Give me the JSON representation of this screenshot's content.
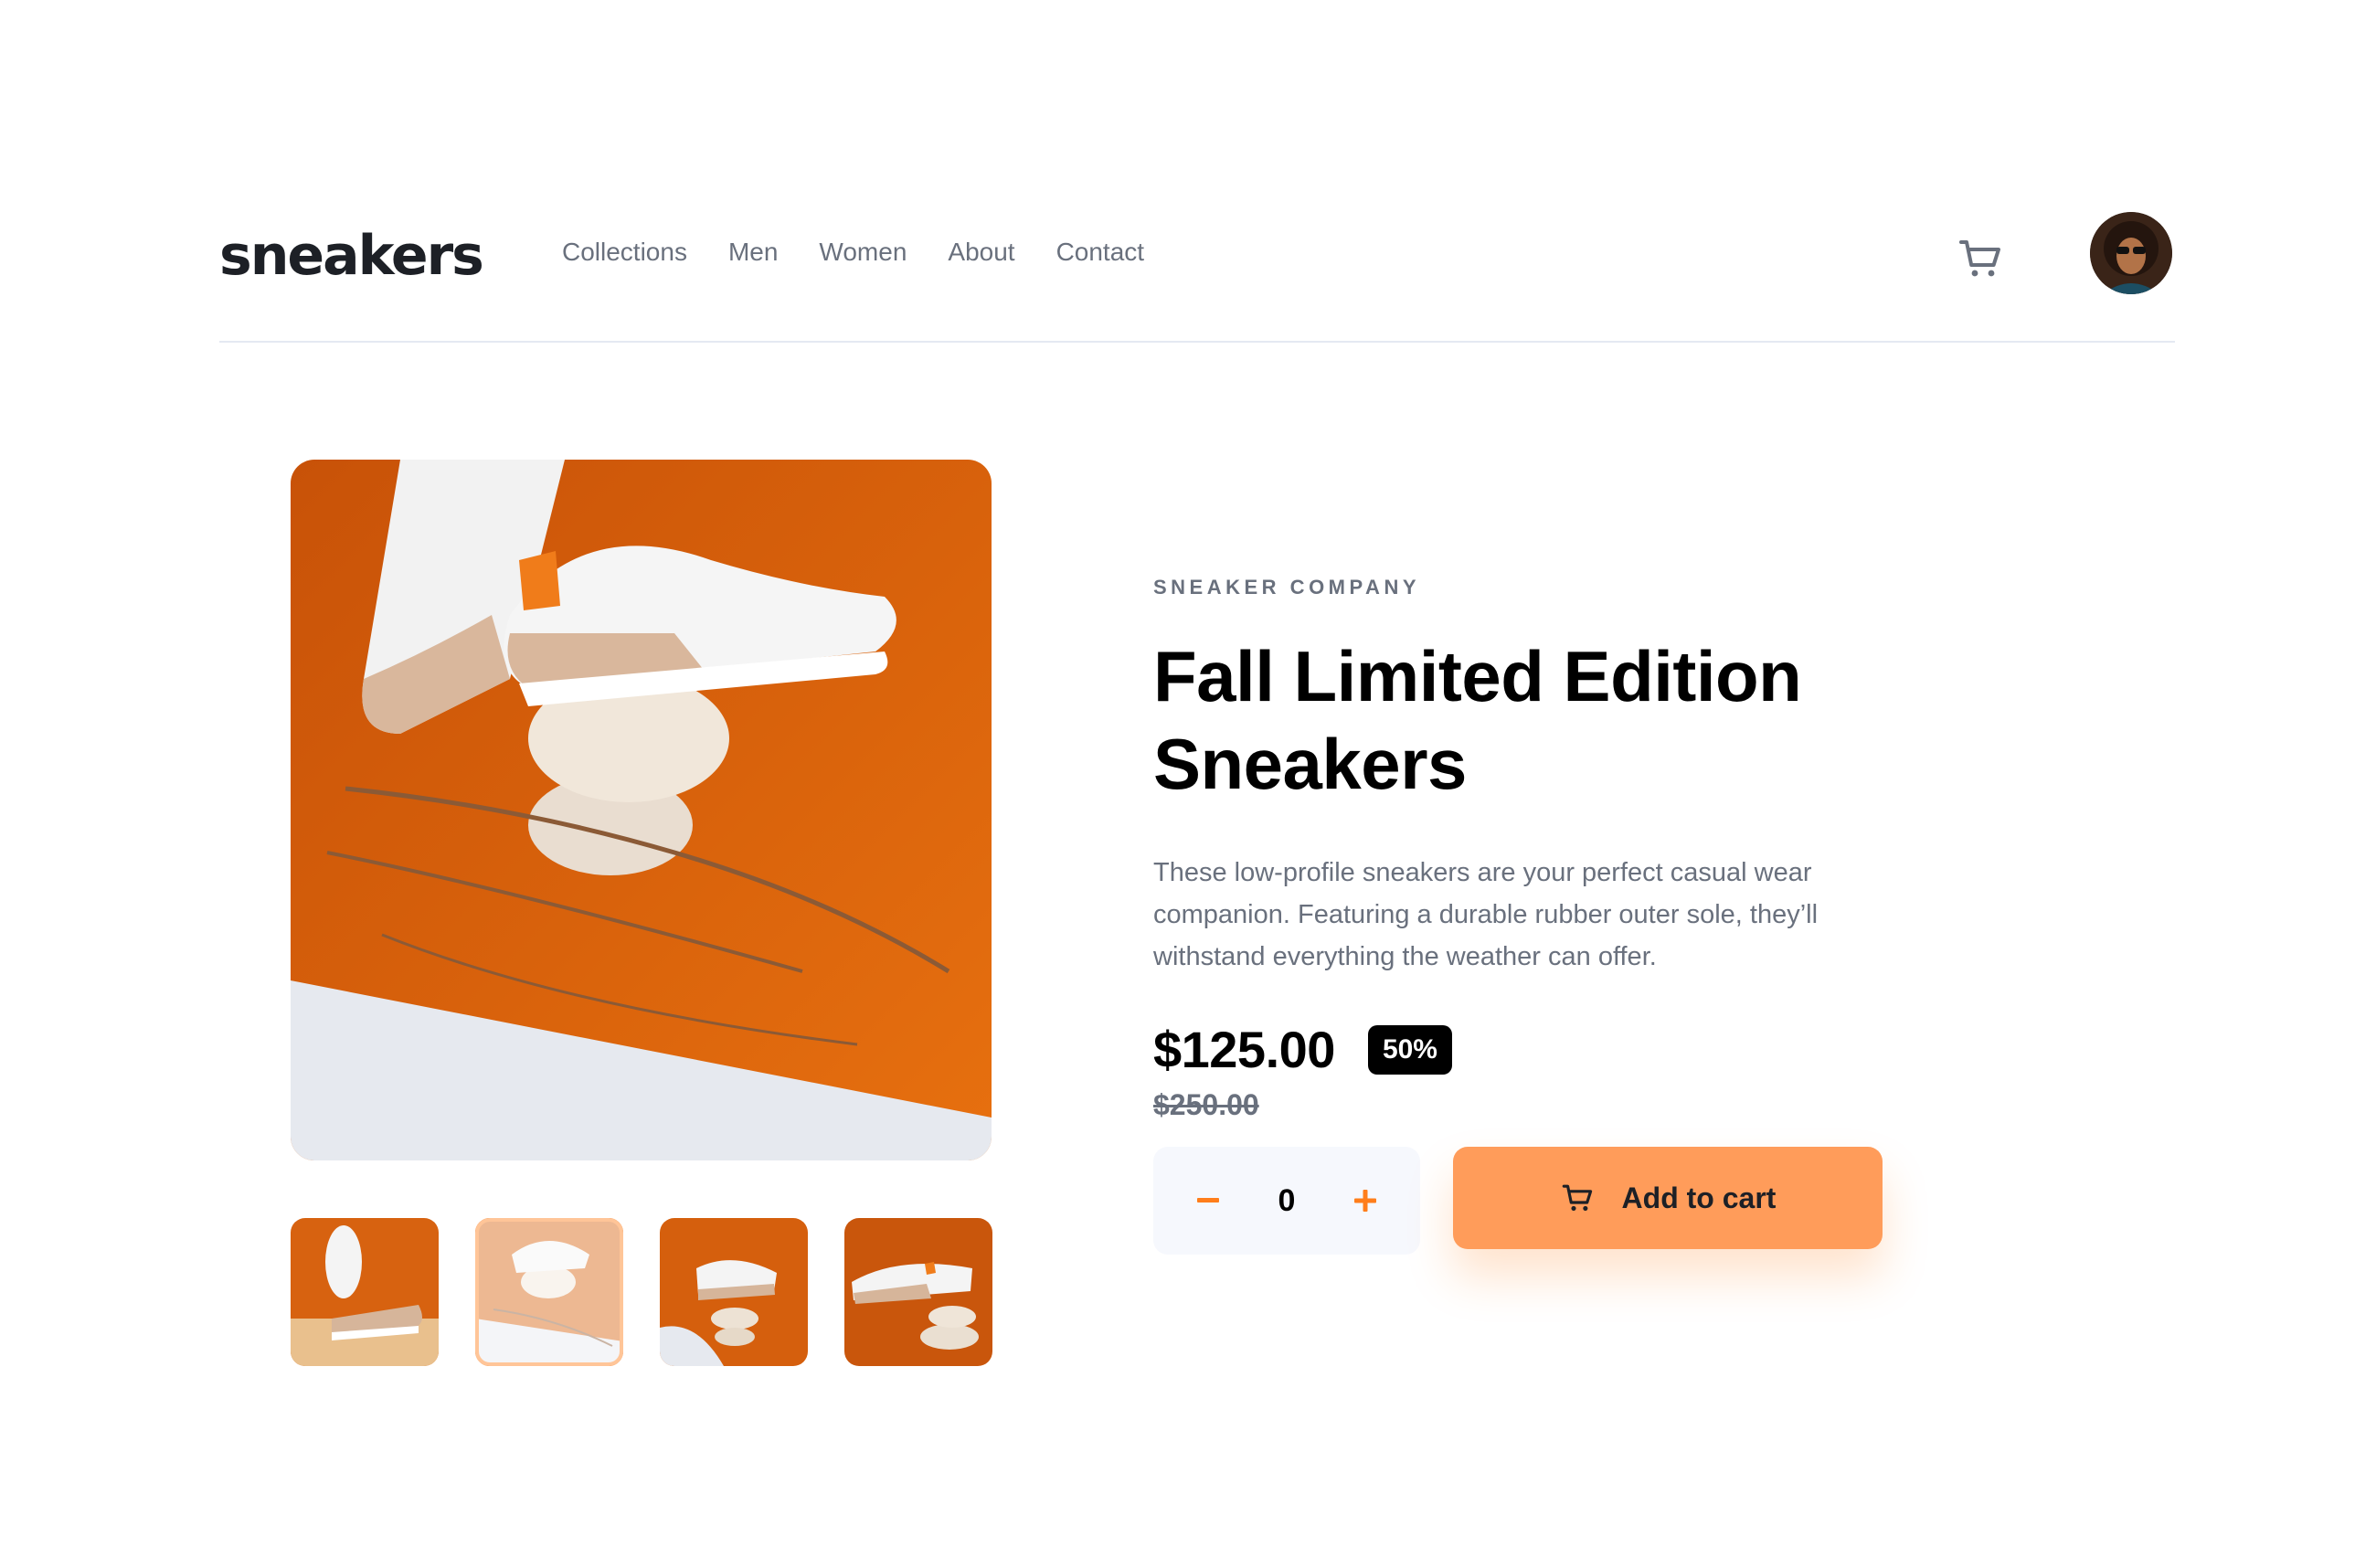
{
  "brand": {
    "logo": "sneakers"
  },
  "nav": {
    "items": [
      "Collections",
      "Men",
      "Women",
      "About",
      "Contact"
    ]
  },
  "icons": {
    "cart": "cart-icon",
    "avatar": "user-avatar",
    "minus": "minus-icon",
    "plus": "plus-icon"
  },
  "colors": {
    "accent": "#ff7e1b",
    "accent_light": "#ff9c5a",
    "text_dark": "#1d2026",
    "text_muted": "#69707d",
    "stepper_bg": "#f6f8fd"
  },
  "gallery": {
    "selected_thumbnail_index": 1,
    "thumbnail_count": 4
  },
  "product": {
    "company": "SNEAKER COMPANY",
    "title_line1": "Fall Limited Edition",
    "title_line2": "Sneakers",
    "description": "These low-profile sneakers are your perfect casual wear companion. Featuring a durable rubber outer sole, they’ll withstand everything the weather can offer.",
    "price": "$125.00",
    "discount": "50%",
    "original_price": "$250.00"
  },
  "cart": {
    "quantity": "0",
    "minus": "−",
    "plus": "+",
    "add_label": "Add to cart"
  }
}
